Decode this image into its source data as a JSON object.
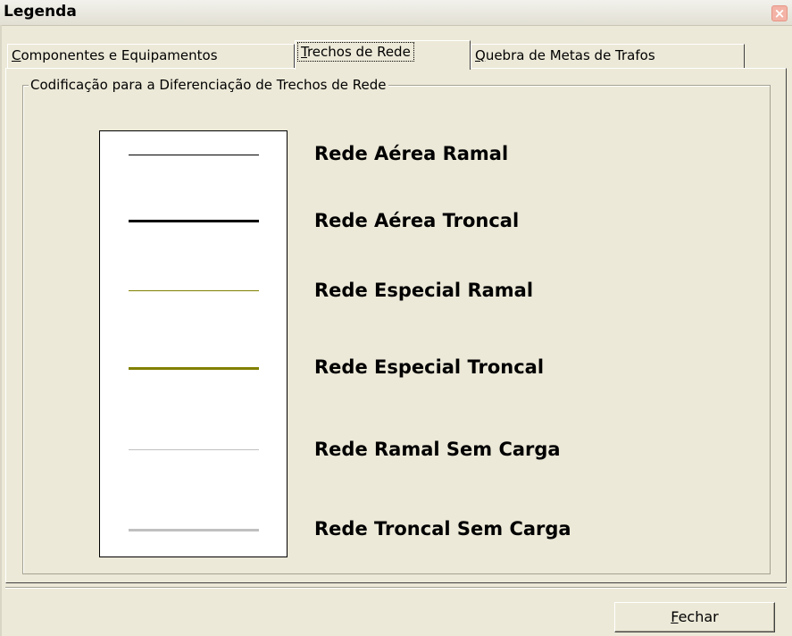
{
  "window": {
    "title": "Legenda",
    "close_icon": "close-icon"
  },
  "tabs": [
    {
      "label_first": "C",
      "label_rest": "omponentes e Equipamentos",
      "active": false
    },
    {
      "label_first": "T",
      "label_rest": "rechos de Rede",
      "active": true
    },
    {
      "label_first": "Q",
      "label_rest": "uebra de Metas de Trafos",
      "active": false
    }
  ],
  "group": {
    "label": "Codificação para a Diferenciação de Trechos de Rede"
  },
  "legend": [
    {
      "label": "Rede Aérea Ramal",
      "color": "#000000"
    },
    {
      "label": "Rede Aérea Troncal",
      "color": "#000000"
    },
    {
      "label": "Rede Especial Ramal",
      "color": "#808000"
    },
    {
      "label": "Rede Especial Troncal",
      "color": "#808000"
    },
    {
      "label": "Rede Ramal Sem Carga",
      "color": "#c0c0c0"
    },
    {
      "label": "Rede Troncal Sem Carga",
      "color": "#c0c0c0"
    }
  ],
  "footer": {
    "close_button_first": "F",
    "close_button_rest": "echar"
  }
}
